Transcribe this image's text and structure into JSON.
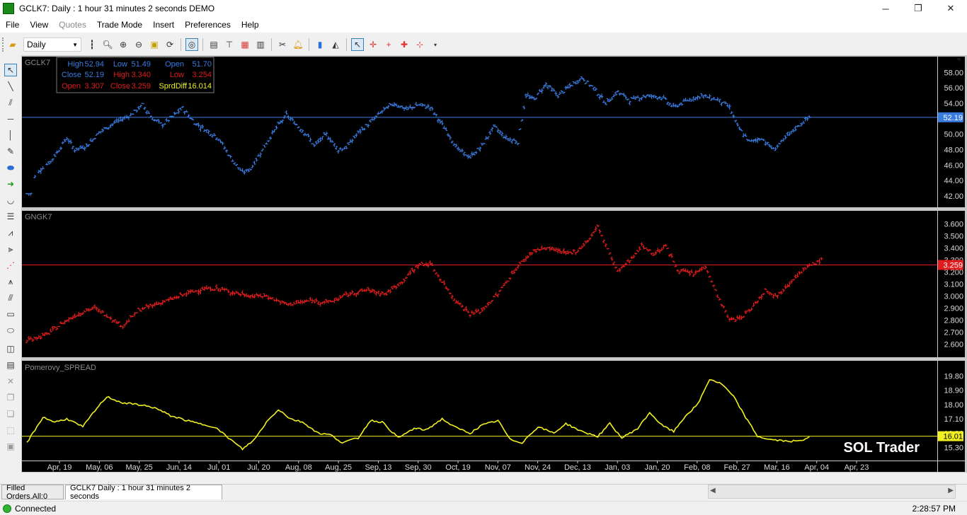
{
  "window": {
    "title": "GCLK7: Daily : 1 hour 31 minutes 2 seconds DEMO",
    "min": "─",
    "max": "❐",
    "close": "✕"
  },
  "menu": [
    "File",
    "View",
    "Quotes",
    "Trade Mode",
    "Insert",
    "Preferences",
    "Help"
  ],
  "toolbar": {
    "period": "Daily"
  },
  "panes": [
    {
      "name": "GCLK7",
      "color": "#3a7be0",
      "ylim": [
        41,
        59.5
      ],
      "ticks": [
        42,
        44,
        46,
        48,
        50,
        52,
        54,
        56,
        58
      ],
      "decimals": 2,
      "last": 52.19,
      "last_label": "52.19",
      "label_bg": "#3a7be0"
    },
    {
      "name": "GNGK7",
      "color": "#e01c1c",
      "ylim": [
        2.52,
        3.68
      ],
      "ticks": [
        2.6,
        2.7,
        2.8,
        2.9,
        3.0,
        3.1,
        3.2,
        3.3,
        3.4,
        3.5,
        3.6
      ],
      "decimals": 3,
      "last": 3.259,
      "last_label": "3.259",
      "label_bg": "#e01c1c"
    },
    {
      "name": "Pomerovy_SPREAD",
      "color": "#f0f020",
      "ylim": [
        14.7,
        20.4
      ],
      "ticks": [
        15.3,
        16.2,
        17.1,
        18.0,
        18.9,
        19.8
      ],
      "decimals": 2,
      "last": 16.01,
      "last_label": "16.01",
      "label_bg": "#f0f020"
    }
  ],
  "info_box": {
    "row1": [
      {
        "k": "High",
        "v": "52.94"
      },
      {
        "k": "Low",
        "v": "51.49"
      },
      {
        "k": "Open",
        "v": "51.70"
      }
    ],
    "row2": [
      {
        "k": "Close",
        "v": "52.19"
      },
      {
        "k": "High",
        "v": "3.340"
      },
      {
        "k": "Low",
        "v": "3.254"
      }
    ],
    "row3": [
      {
        "k": "Open",
        "v": "3.307"
      },
      {
        "k": "Close",
        "v": "3.259"
      },
      {
        "k": "SprdDiff",
        "v": "16.014"
      }
    ]
  },
  "watermark": "SOL Trader",
  "x_axis": [
    "Apr, 19",
    "May, 06",
    "May, 25",
    "Jun, 14",
    "Jul, 01",
    "Jul, 20",
    "Aug, 08",
    "Aug, 25",
    "Sep, 13",
    "Sep, 30",
    "Oct, 19",
    "Nov, 07",
    "Nov, 24",
    "Dec, 13",
    "Jan, 03",
    "Jan, 20",
    "Feb, 08",
    "Feb, 27",
    "Mar, 16",
    "Apr, 04",
    "Apr, 23"
  ],
  "chart_data": [
    {
      "type": "ohlc",
      "title": "GCLK7",
      "anchors": [
        [
          0,
          42.3
        ],
        [
          2,
          42.3
        ],
        [
          4,
          44.5
        ],
        [
          7,
          45.5
        ],
        [
          12,
          46.5
        ],
        [
          16,
          48
        ],
        [
          20,
          49.5
        ],
        [
          24,
          48
        ],
        [
          30,
          48.5
        ],
        [
          36,
          50.2
        ],
        [
          44,
          51.5
        ],
        [
          52,
          52.5
        ],
        [
          58,
          53.8
        ],
        [
          63,
          52
        ],
        [
          68,
          51.2
        ],
        [
          74,
          52.5
        ],
        [
          78,
          53.4
        ],
        [
          84,
          51.5
        ],
        [
          90,
          50.5
        ],
        [
          96,
          49.5
        ],
        [
          102,
          47
        ],
        [
          108,
          45
        ],
        [
          112,
          45.5
        ],
        [
          118,
          48
        ],
        [
          124,
          50.5
        ],
        [
          130,
          52.5
        ],
        [
          136,
          51
        ],
        [
          140,
          50
        ],
        [
          144,
          48.5
        ],
        [
          150,
          50
        ],
        [
          156,
          48
        ],
        [
          160,
          48.3
        ],
        [
          166,
          50.2
        ],
        [
          172,
          51.5
        ],
        [
          178,
          53
        ],
        [
          184,
          54
        ],
        [
          190,
          53.2
        ],
        [
          196,
          53.8
        ],
        [
          202,
          53.5
        ],
        [
          210,
          50.5
        ],
        [
          216,
          48
        ],
        [
          222,
          47
        ],
        [
          228,
          48.5
        ],
        [
          234,
          51
        ],
        [
          240,
          49.5
        ],
        [
          246,
          49
        ],
        [
          250,
          55
        ],
        [
          254,
          54.5
        ],
        [
          260,
          56.5
        ],
        [
          266,
          55
        ],
        [
          272,
          56.2
        ],
        [
          278,
          57.3
        ],
        [
          284,
          56
        ],
        [
          290,
          54
        ],
        [
          296,
          55.5
        ],
        [
          302,
          54.4
        ],
        [
          310,
          55
        ],
        [
          318,
          54.8
        ],
        [
          324,
          53.5
        ],
        [
          332,
          54.5
        ],
        [
          338,
          55
        ],
        [
          346,
          54.5
        ],
        [
          352,
          53.5
        ],
        [
          356,
          51
        ],
        [
          362,
          49
        ],
        [
          368,
          49.5
        ],
        [
          374,
          48
        ],
        [
          380,
          49.5
        ],
        [
          386,
          51
        ],
        [
          392,
          52.2
        ]
      ]
    },
    {
      "type": "ohlc",
      "title": "GNGK7",
      "anchors": [
        [
          0,
          2.63
        ],
        [
          10,
          2.68
        ],
        [
          20,
          2.8
        ],
        [
          28,
          2.87
        ],
        [
          34,
          2.9
        ],
        [
          42,
          2.82
        ],
        [
          48,
          2.75
        ],
        [
          56,
          2.88
        ],
        [
          64,
          2.93
        ],
        [
          72,
          2.97
        ],
        [
          80,
          3.02
        ],
        [
          88,
          3.06
        ],
        [
          96,
          3.06
        ],
        [
          106,
          3.02
        ],
        [
          112,
          3.0
        ],
        [
          120,
          3.0
        ],
        [
          130,
          2.93
        ],
        [
          142,
          2.96
        ],
        [
          152,
          2.95
        ],
        [
          160,
          3.01
        ],
        [
          170,
          3.05
        ],
        [
          180,
          3.02
        ],
        [
          188,
          3.12
        ],
        [
          196,
          3.26
        ],
        [
          202,
          3.27
        ],
        [
          208,
          3.12
        ],
        [
          214,
          2.98
        ],
        [
          222,
          2.85
        ],
        [
          228,
          2.88
        ],
        [
          236,
          3.02
        ],
        [
          246,
          3.25
        ],
        [
          254,
          3.38
        ],
        [
          262,
          3.4
        ],
        [
          270,
          3.35
        ],
        [
          276,
          3.38
        ],
        [
          282,
          3.48
        ],
        [
          286,
          3.58
        ],
        [
          292,
          3.35
        ],
        [
          296,
          3.2
        ],
        [
          302,
          3.3
        ],
        [
          308,
          3.42
        ],
        [
          314,
          3.35
        ],
        [
          320,
          3.42
        ],
        [
          326,
          3.22
        ],
        [
          334,
          3.18
        ],
        [
          340,
          3.25
        ],
        [
          346,
          3.0
        ],
        [
          352,
          2.8
        ],
        [
          358,
          2.82
        ],
        [
          364,
          2.92
        ],
        [
          370,
          3.05
        ],
        [
          376,
          3.0
        ],
        [
          384,
          3.15
        ],
        [
          392,
          3.25
        ],
        [
          398,
          3.3
        ]
      ]
    },
    {
      "type": "line",
      "title": "Pomerovy_SPREAD",
      "anchors": [
        [
          0,
          15.6
        ],
        [
          8,
          17.2
        ],
        [
          14,
          16.9
        ],
        [
          20,
          17.1
        ],
        [
          28,
          16.6
        ],
        [
          34,
          17.6
        ],
        [
          40,
          18.5
        ],
        [
          48,
          18.1
        ],
        [
          56,
          18.0
        ],
        [
          64,
          17.8
        ],
        [
          72,
          17.3
        ],
        [
          80,
          17.0
        ],
        [
          86,
          16.8
        ],
        [
          94,
          16.6
        ],
        [
          102,
          15.8
        ],
        [
          108,
          15.2
        ],
        [
          114,
          15.8
        ],
        [
          120,
          16.9
        ],
        [
          126,
          17.7
        ],
        [
          132,
          17.1
        ],
        [
          138,
          16.9
        ],
        [
          146,
          16.2
        ],
        [
          152,
          16.1
        ],
        [
          158,
          15.6
        ],
        [
          166,
          15.9
        ],
        [
          172,
          17.0
        ],
        [
          178,
          16.9
        ],
        [
          186,
          15.9
        ],
        [
          194,
          16.5
        ],
        [
          200,
          16.4
        ],
        [
          208,
          17.1
        ],
        [
          214,
          16.6
        ],
        [
          222,
          16.2
        ],
        [
          228,
          16.7
        ],
        [
          236,
          17.0
        ],
        [
          242,
          15.8
        ],
        [
          248,
          15.6
        ],
        [
          256,
          16.6
        ],
        [
          264,
          16.2
        ],
        [
          270,
          16.8
        ],
        [
          278,
          16.3
        ],
        [
          286,
          16.0
        ],
        [
          292,
          16.8
        ],
        [
          298,
          15.9
        ],
        [
          306,
          16.5
        ],
        [
          312,
          17.5
        ],
        [
          318,
          16.7
        ],
        [
          324,
          16.3
        ],
        [
          330,
          17.3
        ],
        [
          336,
          18.0
        ],
        [
          342,
          19.6
        ],
        [
          348,
          19.3
        ],
        [
          354,
          18.5
        ],
        [
          360,
          17.2
        ],
        [
          366,
          16.0
        ],
        [
          372,
          15.8
        ],
        [
          380,
          15.7
        ],
        [
          388,
          15.7
        ],
        [
          392,
          16.0
        ]
      ]
    }
  ]
}
